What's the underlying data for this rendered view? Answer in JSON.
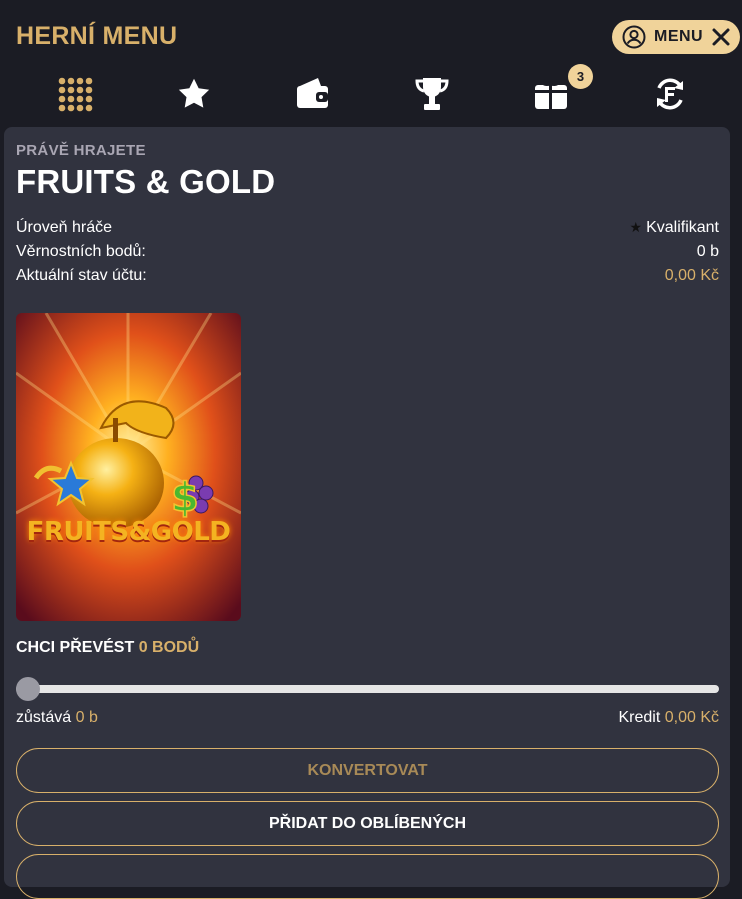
{
  "header": {
    "title": "HERNÍ MENU",
    "menu_label": "MENU",
    "nav_icons": [
      "grid-icon",
      "star-icon",
      "wallet-icon",
      "trophy-icon",
      "gift-icon",
      "refresh-f-icon"
    ],
    "gift_badge": "3"
  },
  "game": {
    "kicker": "PRÁVĚ HRAJETE",
    "title": "FRUITS & GOLD",
    "thumbnail_text": "FRUITS&GOLD"
  },
  "stats": [
    {
      "label": "Úroveň hráče",
      "value": "Kvalifikant"
    },
    {
      "label": "Věrnostních bodů:",
      "value": "0 b"
    },
    {
      "label": "Aktuální stav účtu:",
      "value": "0,00 Kč"
    }
  ],
  "convert": {
    "label": "CHCI PŘEVÉST",
    "amount": "0 BODŮ",
    "slider_value": 0,
    "remain_label": "zůstává",
    "remain_value": "0 b",
    "credit_label": "Kredit",
    "credit_value": "0,00 Kč"
  },
  "buttons": {
    "convert": "KONVERTOVAT",
    "favorite": "PŘIDAT DO OBLÍBENÝCH"
  },
  "colors": {
    "accent": "#d8b06a",
    "panel": "#31333f",
    "background": "#1b1c24",
    "pill": "#f0d39a"
  }
}
